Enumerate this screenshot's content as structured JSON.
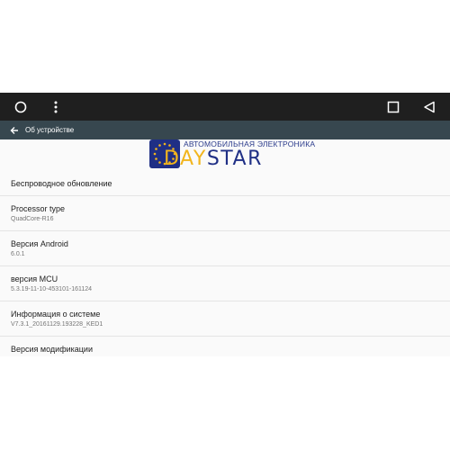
{
  "colors": {
    "navbar_bg": "#1f1f1f",
    "appbar_bg": "#37474f",
    "content_bg": "#fafafa",
    "logo_blue": "#1f2f85",
    "logo_yellow": "#f2b51d"
  },
  "navbar": {
    "icons": [
      "home-circle-icon",
      "menu-dots-icon",
      "recents-square-icon",
      "back-triangle-icon"
    ]
  },
  "appbar": {
    "back_icon": "arrow-left-icon",
    "title": "Об устройстве"
  },
  "logo": {
    "subtitle": "АВТОМОБИЛЬНАЯ ЭЛЕКТРОНИКА",
    "brand_part1": "DAY",
    "brand_part2": "STAR"
  },
  "items": [
    {
      "title": "Беспроводное обновление",
      "summary": ""
    },
    {
      "title": "Processor type",
      "summary": "QuadCore-R16"
    },
    {
      "title": "Версия Android",
      "summary": "6.0.1"
    },
    {
      "title": "версия MCU",
      "summary": "5.3.19-11-10-453101-161124"
    },
    {
      "title": "Информация о системе",
      "summary": "V7.3.1_20161129.193228_KED1"
    },
    {
      "title": "Версия модификации",
      "summary": ""
    }
  ]
}
